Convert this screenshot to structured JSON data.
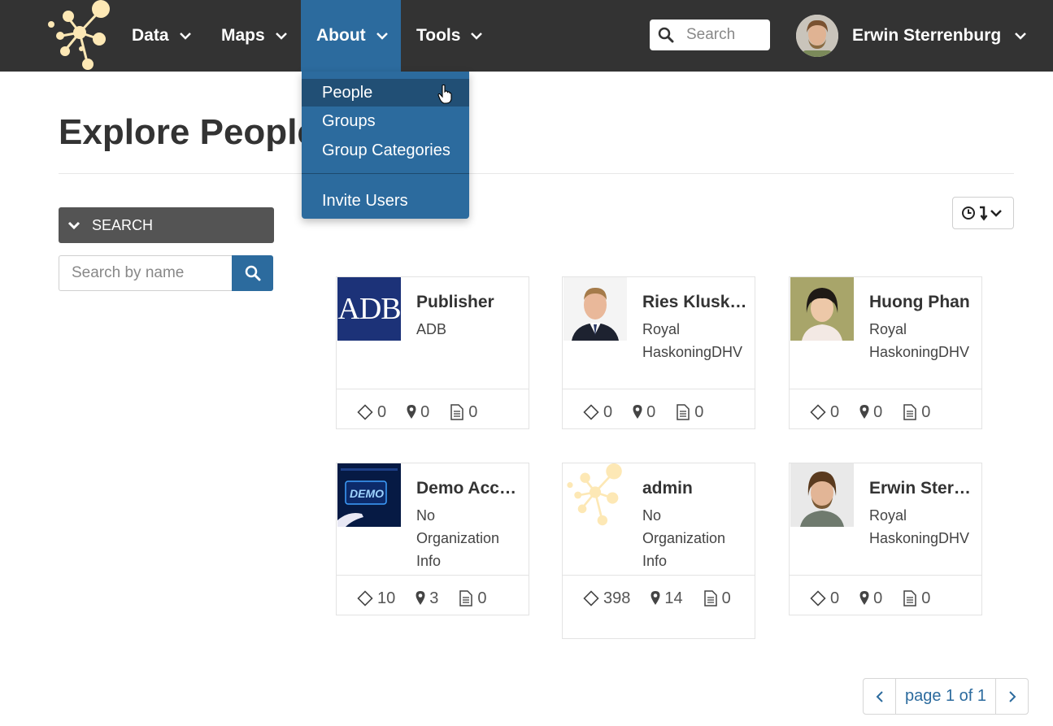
{
  "navbar": {
    "menu": [
      {
        "label": "Data"
      },
      {
        "label": "Maps"
      },
      {
        "label": "About"
      },
      {
        "label": "Tools"
      }
    ],
    "search_placeholder": "Search",
    "user_name": "Erwin Sterrenburg"
  },
  "about_dropdown": {
    "items": [
      {
        "label": "People",
        "active": true
      },
      {
        "label": "Groups"
      },
      {
        "label": "Group Categories"
      },
      {
        "label": "Invite Users"
      }
    ]
  },
  "page": {
    "title": "Explore People",
    "search_toggle_label": "SEARCH",
    "name_search_placeholder": "Search by name"
  },
  "people": [
    {
      "name": "Publisher",
      "org": "ADB",
      "layers": "0",
      "maps": "0",
      "documents": "0",
      "thumb_text": "ADB"
    },
    {
      "name": "Ries Kluskens",
      "org": "Royal HaskoningDHV",
      "layers": "0",
      "maps": "0",
      "documents": "0"
    },
    {
      "name": "Huong Phan",
      "org": "Royal HaskoningDHV",
      "layers": "0",
      "maps": "0",
      "documents": "0"
    },
    {
      "name": "Demo Account",
      "org": "No Organization Info",
      "layers": "10",
      "maps": "3",
      "documents": "0",
      "thumb_text": "DEMO"
    },
    {
      "name": "admin",
      "org": "No Organization Info",
      "layers": "398",
      "maps": "14",
      "documents": "0"
    },
    {
      "name": "Erwin Sterrenburg",
      "org": "Royal HaskoningDHV",
      "layers": "0",
      "maps": "0",
      "documents": "0"
    }
  ],
  "pagination": {
    "label": "page 1 of 1"
  },
  "colors": {
    "navbar": "#333333",
    "accent": "#2c6b9e",
    "logo": "#fde8b5"
  }
}
